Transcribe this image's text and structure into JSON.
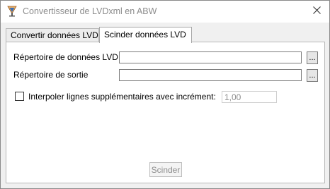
{
  "window": {
    "title": "Convertisseur de LVDxml en ABW"
  },
  "tabs": [
    {
      "label": "Convertir données LVD",
      "active": false
    },
    {
      "label": "Scinder données LVD",
      "active": true
    }
  ],
  "form": {
    "lvd_dir_label": "Répertoire de données LVD",
    "lvd_dir_value": "",
    "output_dir_label": "Répertoire de sortie",
    "output_dir_value": "",
    "browse_label": "...",
    "interpolate_label": "Interpoler lignes supplémentaires avec incrément:",
    "interpolate_checked": false,
    "increment_value": "1,00",
    "split_button_label": "Scinder"
  },
  "icons": {
    "app": "lvd-app-icon",
    "close": "close-icon"
  }
}
